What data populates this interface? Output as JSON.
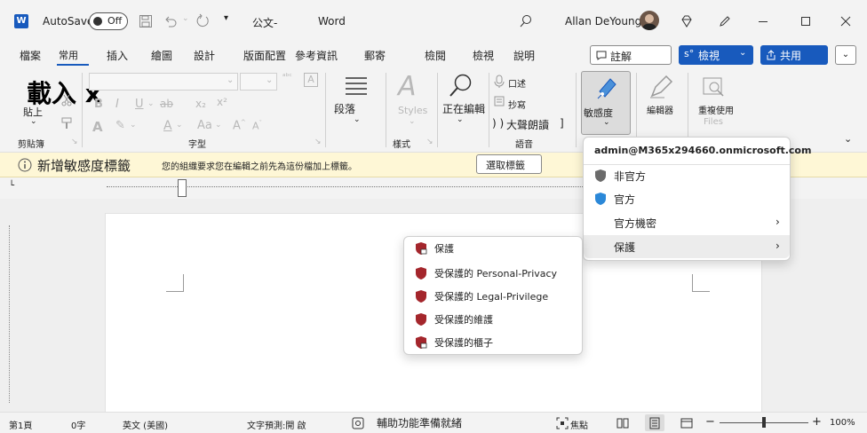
{
  "title_bar": {
    "autosave_label": "AutoSave",
    "toggle_state": "Off",
    "doc_name": "公文-",
    "app_name": "Word",
    "user_name": "Allan DeYoung"
  },
  "menu": {
    "items": [
      "檔案",
      "常用",
      "插入",
      "繪圖",
      "設計",
      "版面配置",
      "參考資訊",
      "郵寄",
      "檢閱",
      "檢視",
      "說明"
    ],
    "comment_label": "註解",
    "view_label": "檢視",
    "share_label": "共用"
  },
  "ribbon": {
    "load_text": "載入 x",
    "paste_label": "貼上",
    "clipboard_group": "剪貼簿",
    "font_group": "字型",
    "paragraph_label": "段落",
    "styles_label": "Styles",
    "styles_group": "樣式",
    "editing_label": "正在編輯",
    "dictate_label": "口述",
    "read_aloud_text": "抄寫",
    "read_label": "大聲朗讀",
    "voice_group": "語音",
    "sensitivity_label": "敏感度",
    "editor_label": "編輯器",
    "reuse_label": "重複使用",
    "files_label": "Files"
  },
  "infobar": {
    "title": "新增敏感度標籤",
    "message": "您的組織要求您在編輯之前先為這份檔加上標籤。",
    "button": "選取標籤"
  },
  "sensitivity_dropdown": {
    "account": "admin@M365x294660.onmicrosoft.com",
    "items": [
      {
        "label": "非官方",
        "icon": "gray-shield-icon",
        "color": "#6b6b6b"
      },
      {
        "label": "官方",
        "icon": "blue-shield-icon",
        "color": "#2b88d8"
      },
      {
        "label": "官方機密",
        "icon": "",
        "color": ""
      },
      {
        "label": "保護",
        "icon": "",
        "color": ""
      }
    ]
  },
  "submenu": {
    "items": [
      {
        "label": "保護",
        "icon": "lock-shield-icon"
      },
      {
        "label": "受保護的 Personal-Privacy",
        "icon": "shield-icon"
      },
      {
        "label": "受保護的 Legal-Privilege",
        "icon": "shield-icon"
      },
      {
        "label": "受保護的維護",
        "icon": "shield-icon"
      },
      {
        "label": "受保護的櫃子",
        "icon": "lock-shield-icon"
      }
    ],
    "shield_color": "#a4262c"
  },
  "status_bar": {
    "page": "第1頁",
    "words": "0字",
    "language": "英文 (美國)",
    "prediction": "文字預測:開 啟",
    "accessibility": "輔助功能準備就緒",
    "focus": "焦點",
    "zoom": "100%"
  }
}
